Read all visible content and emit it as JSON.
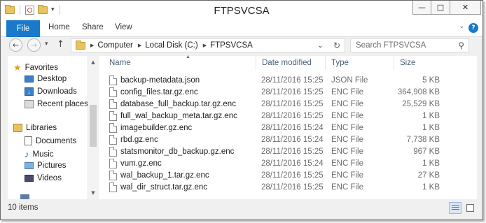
{
  "window": {
    "title": "FTPSVCSA",
    "minimize_glyph": "—",
    "maximize_glyph": "□",
    "close_glyph": "✕"
  },
  "ribbon": {
    "tabs": [
      "File",
      "Home",
      "Share",
      "View"
    ],
    "help_glyph": "?",
    "expand_glyph": "⌄"
  },
  "address": {
    "crumbs": [
      "Computer",
      "Local Disk (C:)",
      "FTPSVCSA"
    ],
    "back_glyph": "←",
    "forward_glyph": "→",
    "up_glyph": "↑",
    "refresh_glyph": "↻",
    "dropdown_glyph": "⌄",
    "breadcrumb_arrow": "▶",
    "history_glyph": "▾"
  },
  "search": {
    "placeholder": "Search FTPSVCSA",
    "icon_glyph": "⚲"
  },
  "navigation": {
    "groups": [
      {
        "label": "Favorites",
        "icon": "star-icon",
        "items": [
          "Desktop",
          "Downloads",
          "Recent places"
        ]
      },
      {
        "label": "Libraries",
        "icon": "libraries-icon",
        "items": [
          "Documents",
          "Music",
          "Pictures",
          "Videos"
        ]
      }
    ],
    "scroll_up": "▲",
    "scroll_down": "▼"
  },
  "columns": {
    "name": "Name",
    "date": "Date modified",
    "type": "Type",
    "size": "Size",
    "sort_glyph": "▲"
  },
  "files": [
    {
      "name": "backup-metadata.json",
      "date": "28/11/2016 15:25",
      "type": "JSON File",
      "size": "5 KB"
    },
    {
      "name": "config_files.tar.gz.enc",
      "date": "28/11/2016 15:25",
      "type": "ENC File",
      "size": "364,908 KB"
    },
    {
      "name": "database_full_backup.tar.gz.enc",
      "date": "28/11/2016 15:25",
      "type": "ENC File",
      "size": "25,529 KB"
    },
    {
      "name": "full_wal_backup_meta.tar.gz.enc",
      "date": "28/11/2016 15:25",
      "type": "ENC File",
      "size": "1 KB"
    },
    {
      "name": "imagebuilder.gz.enc",
      "date": "28/11/2016 15:24",
      "type": "ENC File",
      "size": "1 KB"
    },
    {
      "name": "rbd.gz.enc",
      "date": "28/11/2016 15:24",
      "type": "ENC File",
      "size": "7,738 KB"
    },
    {
      "name": "statsmonitor_db_backup.gz.enc",
      "date": "28/11/2016 15:25",
      "type": "ENC File",
      "size": "967 KB"
    },
    {
      "name": "vum.gz.enc",
      "date": "28/11/2016 15:24",
      "type": "ENC File",
      "size": "1 KB"
    },
    {
      "name": "wal_backup_1.tar.gz.enc",
      "date": "28/11/2016 15:25",
      "type": "ENC File",
      "size": "27 KB"
    },
    {
      "name": "wal_dir_struct.tar.gz.enc",
      "date": "28/11/2016 15:25",
      "type": "ENC File",
      "size": "1 KB"
    }
  ],
  "status": {
    "item_count": "10 items"
  },
  "colors": {
    "accent": "#1979ca",
    "header_text": "#4c607a",
    "folder": "#e8c460"
  }
}
